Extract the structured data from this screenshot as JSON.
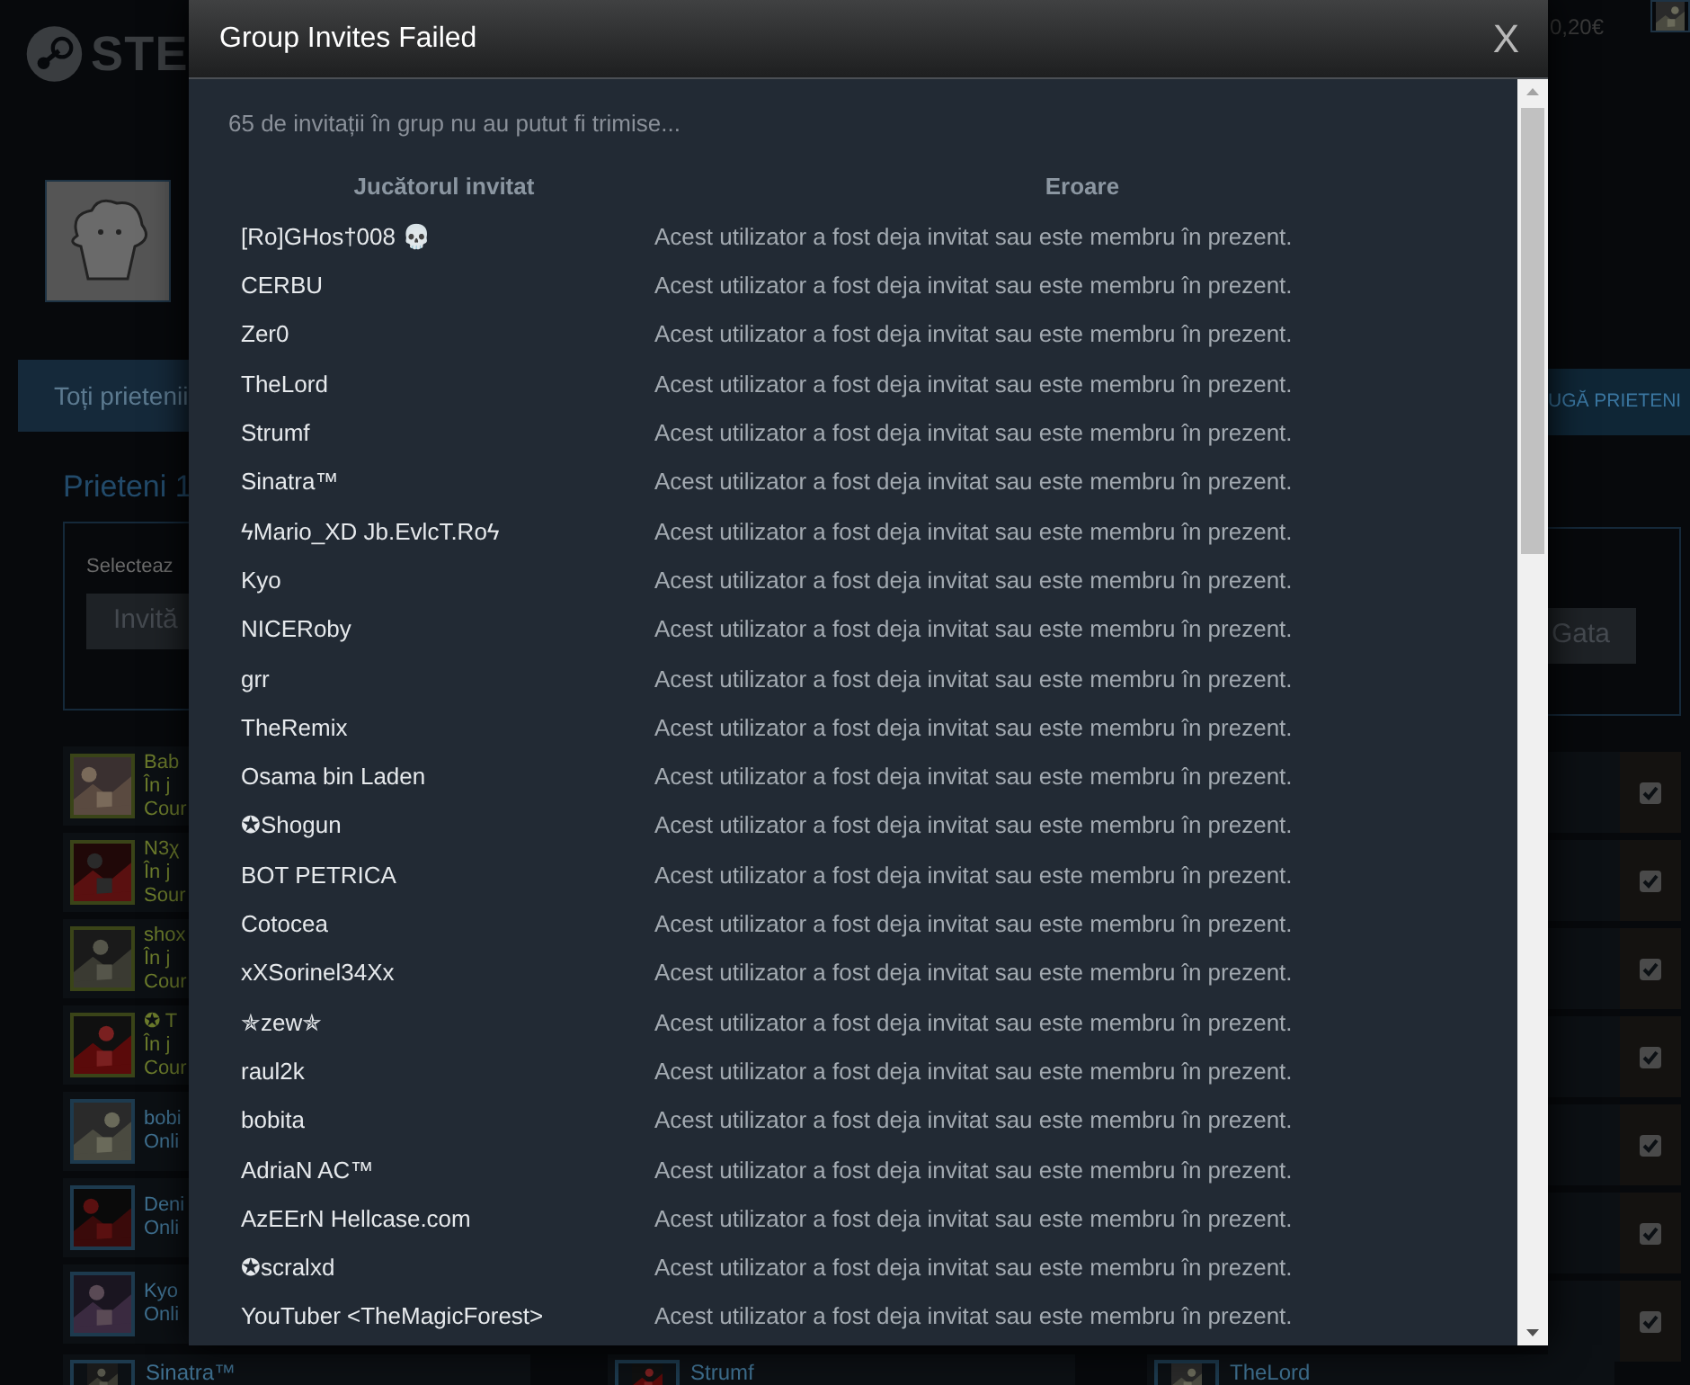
{
  "background": {
    "logo_text": "STE",
    "wallet": "0,20€",
    "tab": "Toți prietenii",
    "add_friends": "UGĂ PRIETENI",
    "friends_heading": "Prieteni 1",
    "select_label": "Selecteaz",
    "invite_button": "Invită",
    "done_button": "Gata",
    "friends": [
      {
        "lines": [
          "Bab",
          "În j",
          "Cour"
        ],
        "kind": "ingame",
        "checked": true
      },
      {
        "lines": [
          "N3χ",
          "În j",
          "Sour"
        ],
        "kind": "ingame",
        "checked": true
      },
      {
        "lines": [
          "shox",
          "În j",
          "Cour"
        ],
        "kind": "ingame",
        "checked": true
      },
      {
        "lines": [
          "✪ T",
          "În j",
          "Cour"
        ],
        "kind": "ingame",
        "checked": true
      },
      {
        "lines": [
          "bobi",
          "Onli"
        ],
        "kind": "online",
        "checked": true
      },
      {
        "lines": [
          "Deni",
          "Onli"
        ],
        "kind": "online",
        "checked": true
      },
      {
        "lines": [
          "Kyo",
          "Onli"
        ],
        "kind": "online",
        "checked": true
      }
    ],
    "bottom_friends": [
      {
        "name": "Sinatra™",
        "kind": "online"
      },
      {
        "name": "Strumf",
        "kind": "online"
      },
      {
        "name": "TheLord",
        "kind": "online"
      }
    ]
  },
  "dialog": {
    "title": "Group Invites Failed",
    "close": "X",
    "summary": "65 de invitații în grup nu au putut fi trimise...",
    "columns": [
      "Jucătorul invitat",
      "Eroare"
    ],
    "rows": [
      {
        "player": "[Ro]GHos†008 💀",
        "error": "Acest utilizator a fost deja invitat sau este membru în prezent."
      },
      {
        "player": "CERBU",
        "error": "Acest utilizator a fost deja invitat sau este membru în prezent."
      },
      {
        "player": "Zer0",
        "error": "Acest utilizator a fost deja invitat sau este membru în prezent."
      },
      {
        "player": "TheLord",
        "error": "Acest utilizator a fost deja invitat sau este membru în prezent."
      },
      {
        "player": "Strumf",
        "error": "Acest utilizator a fost deja invitat sau este membru în prezent."
      },
      {
        "player": "Sinatra™",
        "error": "Acest utilizator a fost deja invitat sau este membru în prezent."
      },
      {
        "player": "ϟMario_XD Jb.EvlcT.Roϟ",
        "error": "Acest utilizator a fost deja invitat sau este membru în prezent."
      },
      {
        "player": "Kyo",
        "error": "Acest utilizator a fost deja invitat sau este membru în prezent."
      },
      {
        "player": "NICERoby",
        "error": "Acest utilizator a fost deja invitat sau este membru în prezent."
      },
      {
        "player": "grr",
        "error": "Acest utilizator a fost deja invitat sau este membru în prezent."
      },
      {
        "player": "TheRemix",
        "error": "Acest utilizator a fost deja invitat sau este membru în prezent."
      },
      {
        "player": "Osama bin Laden",
        "error": "Acest utilizator a fost deja invitat sau este membru în prezent."
      },
      {
        "player": "✪Shogun",
        "error": "Acest utilizator a fost deja invitat sau este membru în prezent."
      },
      {
        "player": "BOT PETRICA",
        "error": "Acest utilizator a fost deja invitat sau este membru în prezent."
      },
      {
        "player": "Cotocea",
        "error": "Acest utilizator a fost deja invitat sau este membru în prezent."
      },
      {
        "player": "xXSorinel34Xx",
        "error": "Acest utilizator a fost deja invitat sau este membru în prezent."
      },
      {
        "player": "✯zew✯",
        "error": "Acest utilizator a fost deja invitat sau este membru în prezent."
      },
      {
        "player": "raul2k",
        "error": "Acest utilizator a fost deja invitat sau este membru în prezent."
      },
      {
        "player": "bobita",
        "error": "Acest utilizator a fost deja invitat sau este membru în prezent."
      },
      {
        "player": "AdriaN AC™",
        "error": "Acest utilizator a fost deja invitat sau este membru în prezent."
      },
      {
        "player": "AzEErN Hellcase.com",
        "error": "Acest utilizator a fost deja invitat sau este membru în prezent."
      },
      {
        "player": "✪scralxd",
        "error": "Acest utilizator a fost deja invitat sau este membru în prezent."
      },
      {
        "player": "YouTuber <TheMagicForest>",
        "error": "Acest utilizator a fost deja invitat sau este membru în prezent."
      }
    ]
  }
}
